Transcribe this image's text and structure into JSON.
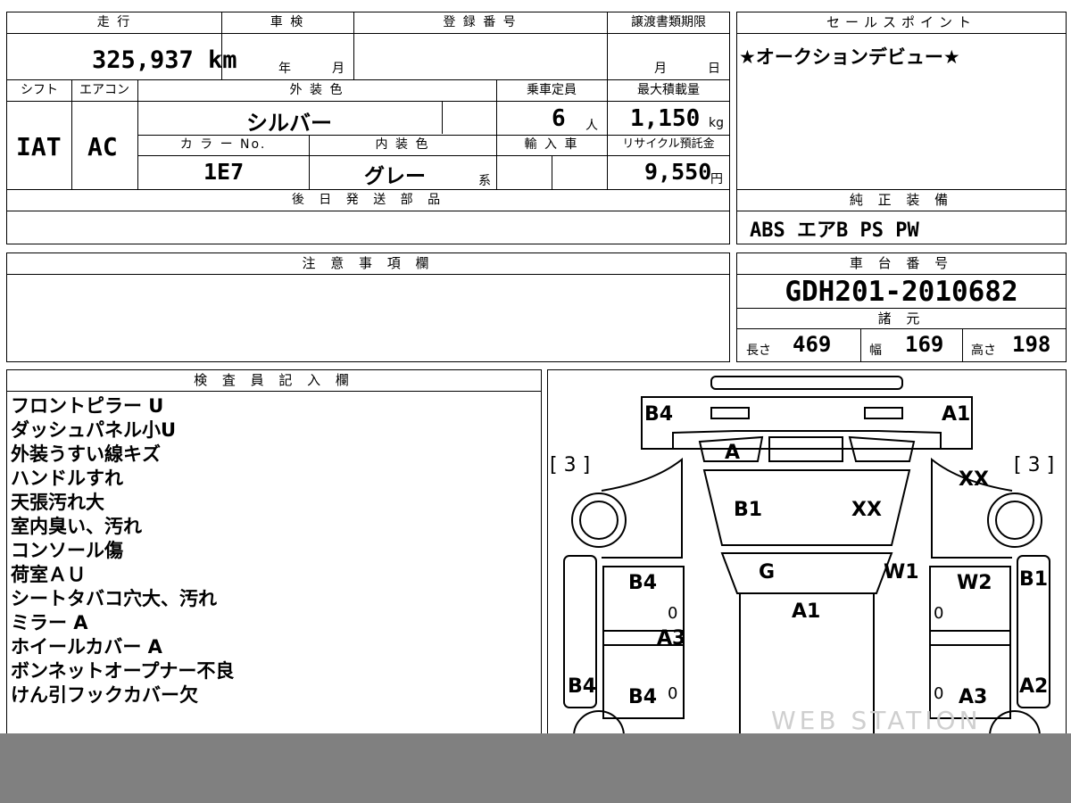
{
  "summary": {
    "mileage_label": "走 行",
    "mileage_value": "325,937 km",
    "inspection_label": "車 検",
    "inspection_year": "年",
    "inspection_month": "月",
    "registration_label": "登 録 番 号",
    "transfer_label": "譲渡書類期限",
    "transfer_month": "月",
    "transfer_day": "日",
    "shift_label": "シフト",
    "shift_value": "IAT",
    "ac_label": "エアコン",
    "ac_value": "AC",
    "exterior_color_label": "外 装 色",
    "exterior_color_value": "シルバー",
    "capacity_label": "乗車定員",
    "capacity_value": "6",
    "capacity_unit": "人",
    "max_load_label": "最大積載量",
    "max_load_value": "1,150",
    "max_load_unit": "kg",
    "color_no_label": "カ ラ ー No.",
    "color_no_value": "1E7",
    "interior_color_label": "内 装 色",
    "interior_color_value": "グレー",
    "interior_suffix": "系",
    "import_label": "輸 入 車",
    "recycle_label": "リサイクル預託金",
    "recycle_value": "9,550",
    "recycle_unit": "円",
    "later_parts_label": "後 日 発 送 部 品",
    "caution_label": "注 意 事 項 欄"
  },
  "sales_point": {
    "label": "セールスポイント",
    "text": "★オークションデビュー★"
  },
  "equipment": {
    "label": "純 正 装 備",
    "text": "ABS エアB PS PW"
  },
  "chassis": {
    "label": "車 台 番 号",
    "value": "GDH201-2010682"
  },
  "specs": {
    "label": "諸 元",
    "length_label": "長さ",
    "length_value": "469",
    "width_label": "幅",
    "width_value": "169",
    "height_label": "高さ",
    "height_value": "198"
  },
  "inspector": {
    "label": "検 査 員 記 入 欄",
    "notes": [
      "フロントピラー U",
      "ダッシュパネル小U",
      "外装うすい線キズ",
      "ハンドルすれ",
      "天張汚れ大",
      "室内臭い、汚れ",
      "コンソール傷",
      "荷室ＡＵ",
      "シートタバコ穴大、汚れ",
      "ミラー A",
      "ホイールカバー A",
      "ボンネットオープナー不良",
      "けん引フックカバー欠"
    ]
  },
  "diagram": {
    "marks": {
      "b4_top_left": "B4",
      "a1_top_right": "A1",
      "bracket_left": "[ 3 ]",
      "bracket_right": "[ 3 ]",
      "a_windshield": "A",
      "xx_right_outer": "XX",
      "b1_hood": "B1",
      "xx_hood": "XX",
      "g_center": "G",
      "w1": "W1",
      "b4_left_door": "B4",
      "w2": "W2",
      "b1_right_side": "B1",
      "a1_roof": "A1",
      "zero_1": "0",
      "zero_2": "0",
      "a3_left": "A3",
      "b4_left_side": "B4",
      "b4_rear_door": "B4",
      "zero_3": "0",
      "zero_4": "0",
      "a3_right": "A3",
      "a2_right_side": "A2"
    },
    "watermark": "WEB STATION"
  }
}
